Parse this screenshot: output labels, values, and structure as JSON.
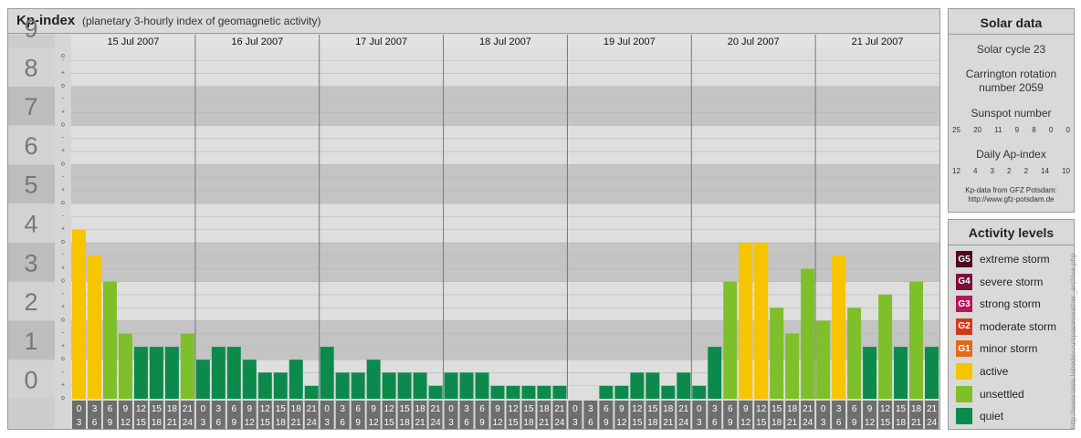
{
  "header": {
    "title": "Kp-index",
    "subtitle": "(planetary 3-hourly index of geomagnetic activity)"
  },
  "chart_data": {
    "type": "bar",
    "title": "Kp-index",
    "subtitle": "(planetary 3-hourly index of geomagnetic activity)",
    "ylim": [
      0,
      9
    ],
    "y_major_ticks": [
      "0",
      "1",
      "2",
      "3",
      "4",
      "5",
      "6",
      "7",
      "8",
      "9"
    ],
    "y_minor_ticks": [
      "o",
      "+",
      "-",
      "o"
    ],
    "days": [
      "15 Jul 2007",
      "16 Jul 2007",
      "17 Jul 2007",
      "18 Jul 2007",
      "19 Jul 2007",
      "20 Jul 2007",
      "21 Jul 2007"
    ],
    "interval_labels": [
      [
        "0",
        "3"
      ],
      [
        "3",
        "6"
      ],
      [
        "6",
        "9"
      ],
      [
        "9",
        "12"
      ],
      [
        "12",
        "15"
      ],
      [
        "15",
        "18"
      ],
      [
        "18",
        "21"
      ],
      [
        "21",
        "24"
      ]
    ],
    "values": [
      [
        4.33,
        3.67,
        3.0,
        1.67,
        1.33,
        1.33,
        1.33,
        1.67
      ],
      [
        1.0,
        1.33,
        1.33,
        1.0,
        0.67,
        0.67,
        1.0,
        0.33
      ],
      [
        1.33,
        0.67,
        0.67,
        1.0,
        0.67,
        0.67,
        0.67,
        0.33
      ],
      [
        0.67,
        0.67,
        0.67,
        0.33,
        0.33,
        0.33,
        0.33,
        0.33
      ],
      [
        0.0,
        0.0,
        0.33,
        0.33,
        0.67,
        0.67,
        0.33,
        0.67
      ],
      [
        0.33,
        1.33,
        3.0,
        4.0,
        4.0,
        2.33,
        1.67,
        3.33
      ],
      [
        2.0,
        3.67,
        2.33,
        1.33,
        2.67,
        1.33,
        3.0,
        1.33
      ]
    ],
    "colors": {
      "quiet": "#0b8a4c",
      "unsettled": "#7dc02a",
      "active": "#f6c400"
    }
  },
  "solar": {
    "title": "Solar data",
    "cycle": "Solar cycle 23",
    "carrington_line1": "Carrington rotation",
    "carrington_line2": "number 2059",
    "sunspot_label": "Sunspot number",
    "sunspot_values": [
      "25",
      "20",
      "11",
      "9",
      "8",
      "0",
      "0"
    ],
    "ap_label": "Daily Ap-index",
    "ap_values": [
      "12",
      "4",
      "3",
      "2",
      "2",
      "14",
      "10"
    ],
    "source_line1": "Kp-data from GFZ Potsdam:",
    "source_line2": "http://www.gfz-potsdam.de"
  },
  "activity": {
    "title": "Activity levels",
    "levels": [
      {
        "badge": "G5",
        "label": "extreme storm",
        "color": "#4d0a22"
      },
      {
        "badge": "G4",
        "label": "severe storm",
        "color": "#7a0e3c"
      },
      {
        "badge": "G3",
        "label": "strong storm",
        "color": "#b3185a"
      },
      {
        "badge": "G2",
        "label": "moderate storm",
        "color": "#d03a1c"
      },
      {
        "badge": "G1",
        "label": "minor storm",
        "color": "#e06a1a"
      },
      {
        "badge": "",
        "label": "active",
        "color": "#f6c400"
      },
      {
        "badge": "",
        "label": "unsettled",
        "color": "#7dc02a"
      },
      {
        "badge": "",
        "label": "quiet",
        "color": "#0b8a4c"
      }
    ]
  },
  "watermark": "http://www.tesis.lebedev.ru/spaceweather_archive.php"
}
